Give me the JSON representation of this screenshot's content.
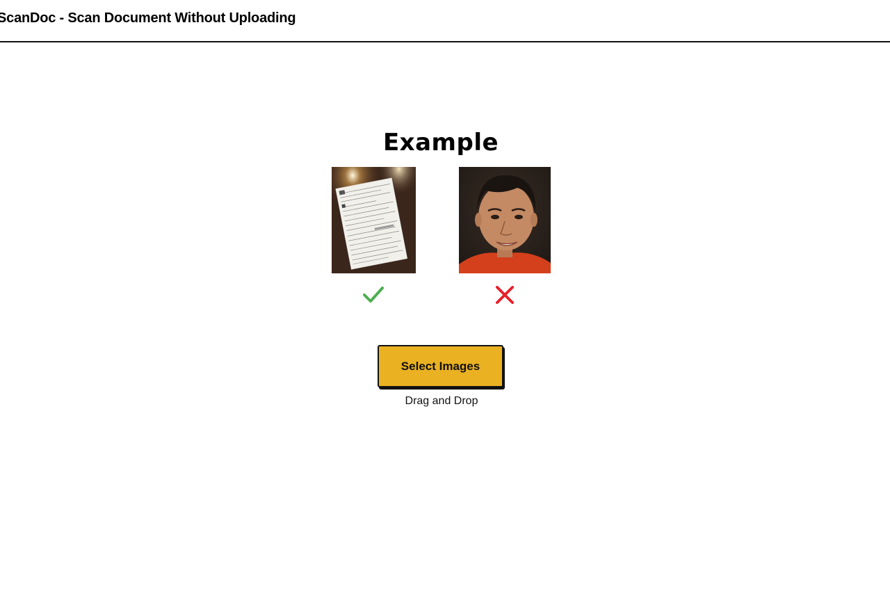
{
  "header": {
    "title": "ScanDoc - Scan Document Without Uploading"
  },
  "example": {
    "heading": "Example",
    "items": [
      {
        "image": "document-photo",
        "verdict": "check-icon",
        "verdict_color": "#4caf50"
      },
      {
        "image": "face-photo",
        "verdict": "cross-icon",
        "verdict_color": "#e8202a"
      }
    ]
  },
  "upload": {
    "button_label": "Select Images",
    "hint": "Drag and Drop",
    "button_color": "#eab123"
  }
}
